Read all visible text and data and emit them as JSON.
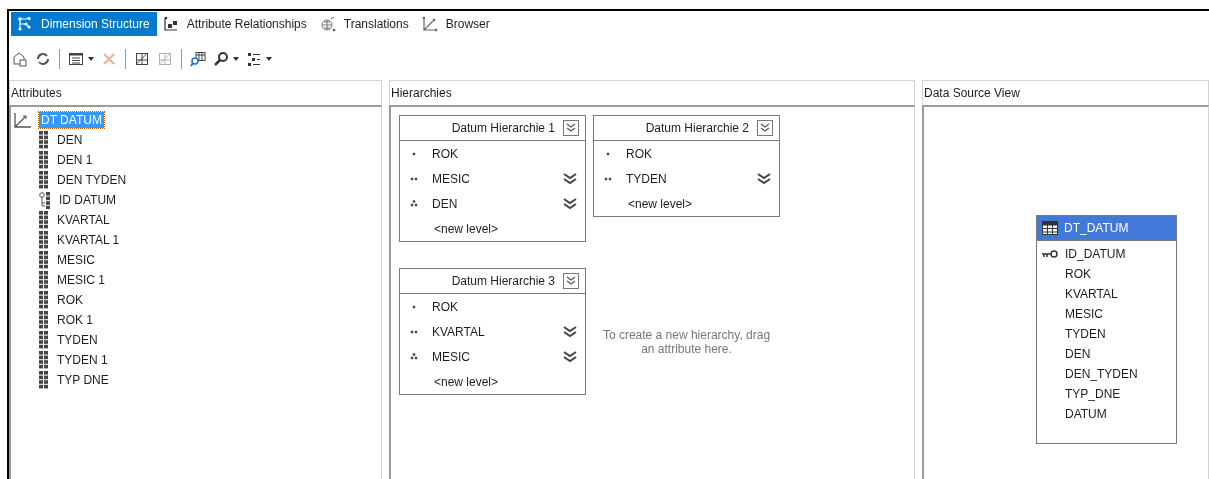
{
  "tabs": [
    {
      "label": "Dimension Structure",
      "kind": "structure",
      "selected": true
    },
    {
      "label": "Attribute Relationships",
      "kind": "relationships",
      "selected": false
    },
    {
      "label": "Translations",
      "kind": "translations",
      "selected": false
    },
    {
      "label": "Browser",
      "kind": "browser",
      "selected": false
    }
  ],
  "toolbar": [
    {
      "kind": "deploy",
      "disabled": false
    },
    {
      "kind": "refresh",
      "disabled": false
    },
    {
      "kind": "separator"
    },
    {
      "kind": "view",
      "disabled": false,
      "menu": true
    },
    {
      "kind": "delete",
      "disabled": true
    },
    {
      "kind": "separator"
    },
    {
      "kind": "grid",
      "disabled": false
    },
    {
      "kind": "grid",
      "disabled": true
    },
    {
      "kind": "separator"
    },
    {
      "kind": "query",
      "disabled": false
    },
    {
      "kind": "zoom",
      "disabled": false,
      "menu": true
    },
    {
      "kind": "layout",
      "disabled": false,
      "menu": true
    }
  ],
  "attributes": {
    "title": "Attributes",
    "tree": [
      {
        "label": "DT DATUM",
        "kind": "dimension",
        "selected": true,
        "children": [
          {
            "label": "DEN",
            "kind": "attribute",
            "selected": false
          },
          {
            "label": "DEN 1",
            "kind": "attribute",
            "selected": false
          },
          {
            "label": "DEN TYDEN",
            "kind": "attribute",
            "selected": false
          },
          {
            "label": "ID DATUM",
            "kind": "key",
            "selected": false
          },
          {
            "label": "KVARTAL",
            "kind": "attribute",
            "selected": false
          },
          {
            "label": "KVARTAL 1",
            "kind": "attribute",
            "selected": false
          },
          {
            "label": "MESIC",
            "kind": "attribute",
            "selected": false
          },
          {
            "label": "MESIC 1",
            "kind": "attribute",
            "selected": false
          },
          {
            "label": "ROK",
            "kind": "attribute",
            "selected": false
          },
          {
            "label": "ROK 1",
            "kind": "attribute",
            "selected": false
          },
          {
            "label": "TYDEN",
            "kind": "attribute",
            "selected": false
          },
          {
            "label": "TYDEN 1",
            "kind": "attribute",
            "selected": false
          },
          {
            "label": "TYP DNE",
            "kind": "attribute",
            "selected": false
          }
        ]
      }
    ]
  },
  "hierarchies": {
    "title": "Hierarchies",
    "items": [
      {
        "title": "Datum Hierarchie 1",
        "levels": [
          {
            "name": "ROK",
            "warning": false
          },
          {
            "name": "MESIC",
            "warning": true
          },
          {
            "name": "DEN",
            "warning": true
          }
        ],
        "new_level": "<new level>"
      },
      {
        "title": "Datum Hierarchie 2",
        "levels": [
          {
            "name": "ROK",
            "warning": false
          },
          {
            "name": "TYDEN",
            "warning": true
          }
        ],
        "new_level": "<new level>"
      },
      {
        "title": "Datum Hierarchie 3",
        "levels": [
          {
            "name": "ROK",
            "warning": false
          },
          {
            "name": "KVARTAL",
            "warning": true
          },
          {
            "name": "MESIC",
            "warning": true
          }
        ],
        "new_level": "<new level>"
      }
    ],
    "hint": "To create a new hierarchy, drag an attribute here."
  },
  "data_source_view": {
    "title": "Data Source View",
    "table": {
      "name": "DT_DATUM",
      "selected": true,
      "columns": [
        {
          "name": "ID_DATUM",
          "key": true
        },
        {
          "name": "ROK",
          "key": false
        },
        {
          "name": "KVARTAL",
          "key": false
        },
        {
          "name": "MESIC",
          "key": false
        },
        {
          "name": "TYDEN",
          "key": false
        },
        {
          "name": "DEN",
          "key": false
        },
        {
          "name": "DEN_TYDEN",
          "key": false
        },
        {
          "name": "TYP_DNE",
          "key": false
        },
        {
          "name": "DATUM",
          "key": false
        }
      ]
    }
  }
}
